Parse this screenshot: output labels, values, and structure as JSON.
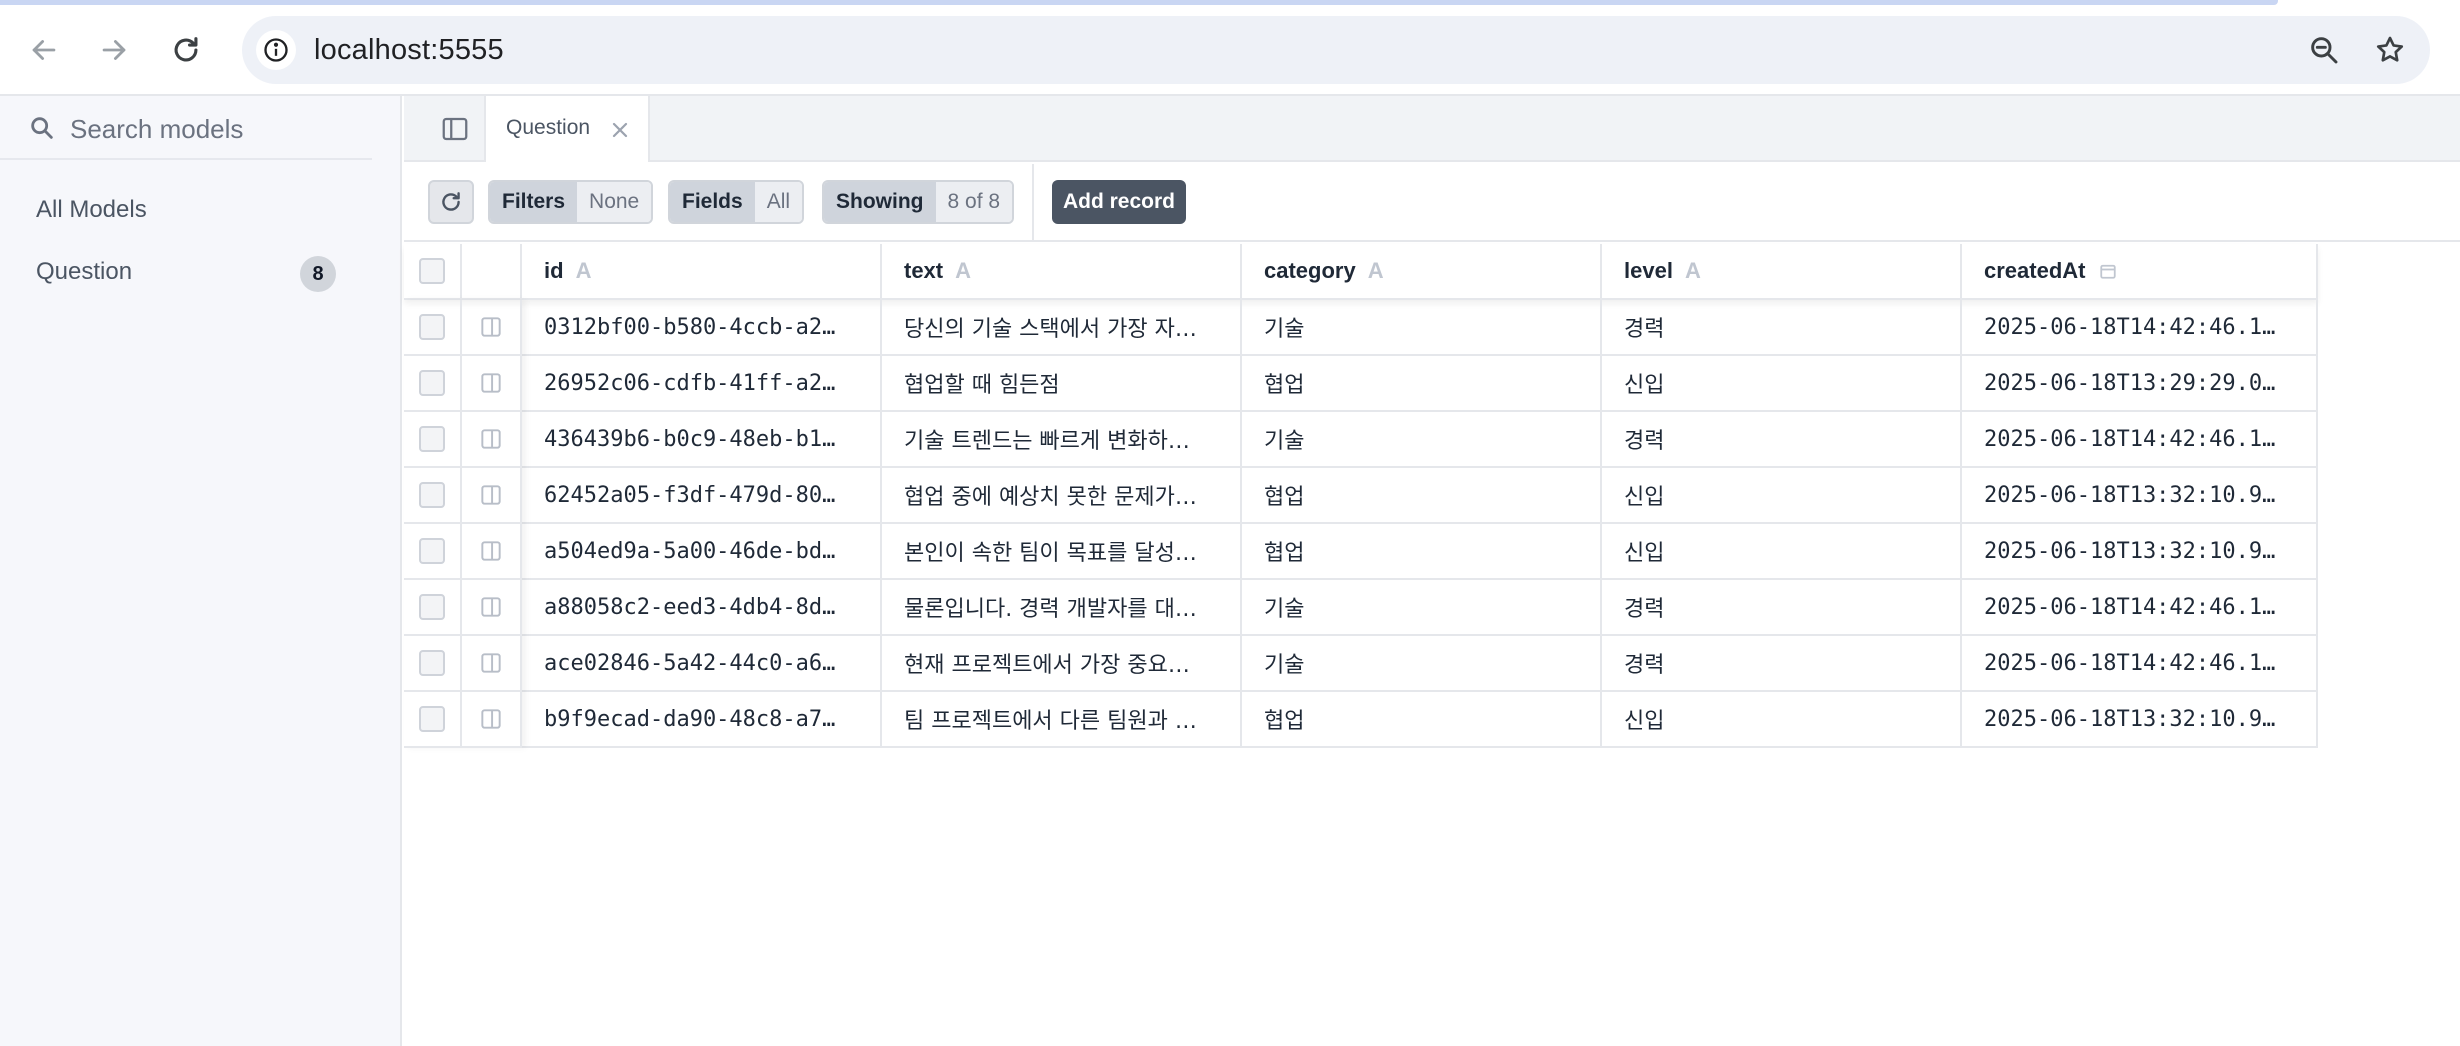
{
  "browser": {
    "url": "localhost:5555"
  },
  "sidebar": {
    "search_placeholder": "Search models",
    "all_models_label": "All Models",
    "models": [
      {
        "name": "Question",
        "count": "8"
      }
    ]
  },
  "tabs": [
    {
      "label": "Question"
    }
  ],
  "toolbar": {
    "filters_label": "Filters",
    "filters_value": "None",
    "fields_label": "Fields",
    "fields_value": "All",
    "showing_label": "Showing",
    "showing_value": "8 of 8",
    "add_record_label": "Add record"
  },
  "table": {
    "columns": [
      {
        "label": "id",
        "type_icon": "A"
      },
      {
        "label": "text",
        "type_icon": "A"
      },
      {
        "label": "category",
        "type_icon": "A"
      },
      {
        "label": "level",
        "type_icon": "A"
      },
      {
        "label": "createdAt",
        "type_icon": "calendar-icon"
      }
    ],
    "rows": [
      [
        "0312bf00-b580-4ccb-a2…",
        "당신의 기술 스택에서 가장 자…",
        "기술",
        "경력",
        "2025-06-18T14:42:46.1…"
      ],
      [
        "26952c06-cdfb-41ff-a2…",
        "협업할 때 힘든점",
        "협업",
        "신입",
        "2025-06-18T13:29:29.0…"
      ],
      [
        "436439b6-b0c9-48eb-b1…",
        "기술 트렌드는 빠르게 변화하…",
        "기술",
        "경력",
        "2025-06-18T14:42:46.1…"
      ],
      [
        "62452a05-f3df-479d-80…",
        "협업 중에 예상치 못한 문제가…",
        "협업",
        "신입",
        "2025-06-18T13:32:10.9…"
      ],
      [
        "a504ed9a-5a00-46de-bd…",
        "본인이 속한 팀이 목표를 달성…",
        "협업",
        "신입",
        "2025-06-18T13:32:10.9…"
      ],
      [
        "a88058c2-eed3-4db4-8d…",
        "물론입니다. 경력 개발자를 대…",
        "기술",
        "경력",
        "2025-06-18T14:42:46.1…"
      ],
      [
        "ace02846-5a42-44c0-a6…",
        "현재 프로젝트에서 가장 중요…",
        "기술",
        "경력",
        "2025-06-18T14:42:46.1…"
      ],
      [
        "b9f9ecad-da90-48c8-a7…",
        "팀 프로젝트에서 다른 팀원과 …",
        "협업",
        "신입",
        "2025-06-18T13:32:10.9…"
      ]
    ]
  }
}
